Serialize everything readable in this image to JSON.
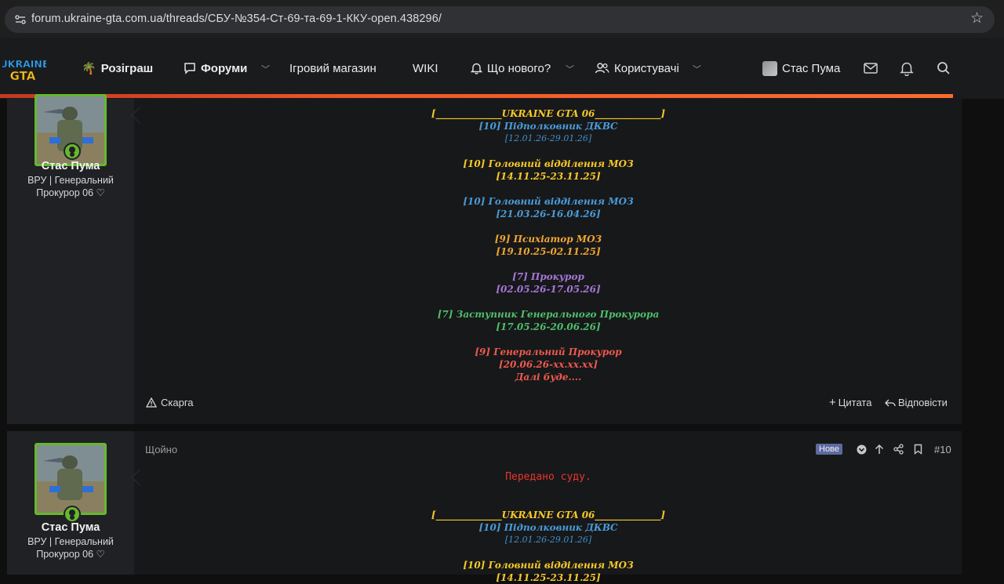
{
  "browser": {
    "url": "forum.ukraine-gta.com.ua/threads/СБУ-№354-Ст-69-та-69-1-ККУ-open.438296/"
  },
  "nav": {
    "logo_line1": "UKRAINE",
    "logo_line2": "GTA",
    "giveaway": "Розіграш",
    "forums": "Форуми",
    "shop": "Ігровий магазин",
    "wiki": "WIKI",
    "whats_new": "Що нового?",
    "users": "Користувачі",
    "current_user": "Стас Пума",
    "accent_color": "#f0582a"
  },
  "post1": {
    "username": "Стас Пума",
    "title_line1": "ВРУ | Генеральний",
    "title_line2": "Прокурор 06 ♡",
    "lines": [
      {
        "text": "[______________UKRAINE GTA 06______________]",
        "cls": "yellow"
      },
      {
        "text": "[10] Підполковник ДКВС",
        "cls": "blue"
      },
      {
        "text": "[12.01.26-29.01.26]",
        "cls": "blue-light"
      },
      {
        "text": "",
        "cls": ""
      },
      {
        "text": "[10] Головний відділення МОЗ",
        "cls": "yellow"
      },
      {
        "text": "[14.11.25-23.11.25]",
        "cls": "yellow"
      },
      {
        "text": "",
        "cls": ""
      },
      {
        "text": "[10] Головний відділення МОЗ",
        "cls": "blue"
      },
      {
        "text": "[21.03.26-16.04.26]",
        "cls": "blue"
      },
      {
        "text": "",
        "cls": ""
      },
      {
        "text": "[9] Психіатор МОЗ",
        "cls": "orange"
      },
      {
        "text": "[19.10.25-02.11.25]",
        "cls": "orange"
      },
      {
        "text": "",
        "cls": ""
      },
      {
        "text": "[7] Прокурор",
        "cls": "purple"
      },
      {
        "text": "[02.05.26-17.05.26]",
        "cls": "purple"
      },
      {
        "text": "",
        "cls": ""
      },
      {
        "text": "[7] Заступник Генерального Прокурора",
        "cls": "green"
      },
      {
        "text": "[17.05.26-20.06.26]",
        "cls": "green"
      },
      {
        "text": "",
        "cls": ""
      },
      {
        "text": "[9] Генеральний Прокурор",
        "cls": "red"
      },
      {
        "text": "[20.06.26-xx.xx.xx]",
        "cls": "red"
      },
      {
        "text": "Далі буде....",
        "cls": "red"
      }
    ],
    "report": "Скарга",
    "quote": "Цитата",
    "reply": "Відповісти"
  },
  "post2": {
    "username": "Стас Пума",
    "title_line1": "ВРУ | Генеральний",
    "title_line2": "Прокурор 06 ♡",
    "time": "Щойно",
    "badge": "Нове",
    "post_number": "#10",
    "lines": [
      {
        "text": "Передано суду.",
        "cls": "mono-red"
      },
      {
        "text": "",
        "cls": ""
      },
      {
        "text": "",
        "cls": ""
      },
      {
        "text": "[______________UKRAINE GTA 06______________]",
        "cls": "yellow"
      },
      {
        "text": "[10] Підполковник ДКВС",
        "cls": "blue"
      },
      {
        "text": "[12.01.26-29.01.26]",
        "cls": "blue-light"
      },
      {
        "text": "",
        "cls": ""
      },
      {
        "text": "[10] Головний відділення МОЗ",
        "cls": "yellow"
      },
      {
        "text": "[14.11.25-23.11.25]",
        "cls": "yellow"
      }
    ]
  }
}
